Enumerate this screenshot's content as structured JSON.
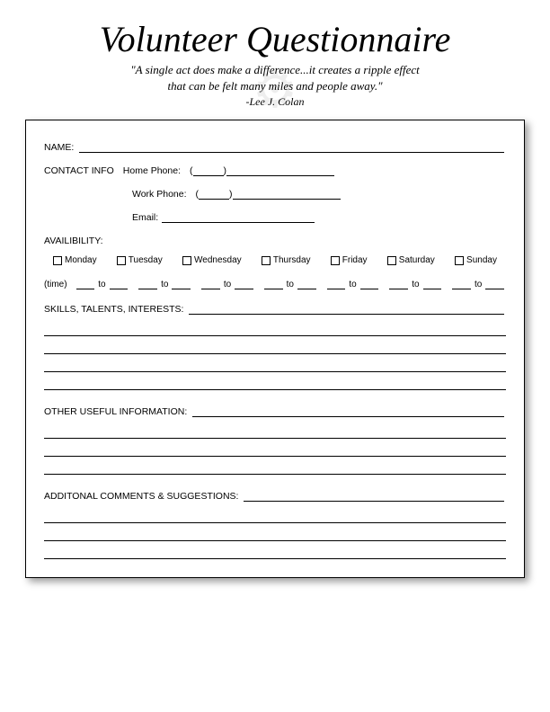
{
  "title": "Volunteer Questionnaire",
  "quote_line1": "\"A single act does make a difference...it creates a ripple effect",
  "quote_line2": "that can be felt many miles and people away.\"",
  "attribution": "-Lee J. Colan",
  "labels": {
    "name": "NAME:",
    "contact": "CONTACT INFO",
    "home_phone": "Home Phone:",
    "work_phone": "Work Phone:",
    "email": "Email:",
    "availability": "AVAILIBILITY:",
    "time": "(time)",
    "to": "to",
    "skills": "SKILLS, TALENTS, INTERESTS:",
    "other": "OTHER USEFUL INFORMATION:",
    "additional": "ADDITONAL COMMENTS & SUGGESTIONS:"
  },
  "days": [
    "Monday",
    "Tuesday",
    "Wednesday",
    "Thursday",
    "Friday",
    "Saturday",
    "Sunday"
  ]
}
